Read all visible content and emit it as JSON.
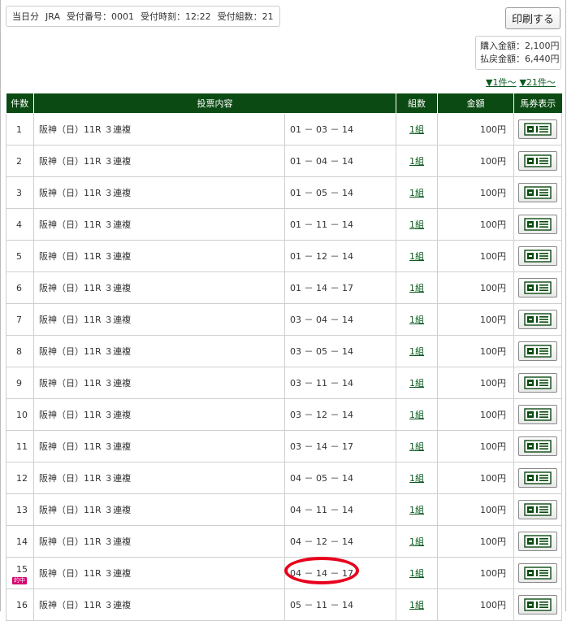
{
  "header": {
    "date_label": "当日分",
    "org": "JRA",
    "receipt_no": "受付番号：0001",
    "receipt_time": "受付時刻：12:22",
    "receipt_count": "受付組数：21"
  },
  "print_button": "印刷する",
  "amounts": {
    "purchase": "購入金額：2,100円",
    "payout": "払戻金額：6,440円"
  },
  "jump_links": [
    "▼1件～",
    "▼21件～"
  ],
  "table": {
    "headers": [
      "件数",
      "投票内容",
      "組数",
      "金額",
      "馬券表示"
    ],
    "hit_badge": "的中",
    "rows": [
      {
        "idx": "1",
        "race": "阪神（日）11R ３連複",
        "combo": "01 － 03 － 14",
        "kumi": "1組",
        "amount": "100円",
        "hit": false
      },
      {
        "idx": "2",
        "race": "阪神（日）11R ３連複",
        "combo": "01 － 04 － 14",
        "kumi": "1組",
        "amount": "100円",
        "hit": false
      },
      {
        "idx": "3",
        "race": "阪神（日）11R ３連複",
        "combo": "01 － 05 － 14",
        "kumi": "1組",
        "amount": "100円",
        "hit": false
      },
      {
        "idx": "4",
        "race": "阪神（日）11R ３連複",
        "combo": "01 － 11 － 14",
        "kumi": "1組",
        "amount": "100円",
        "hit": false
      },
      {
        "idx": "5",
        "race": "阪神（日）11R ３連複",
        "combo": "01 － 12 － 14",
        "kumi": "1組",
        "amount": "100円",
        "hit": false
      },
      {
        "idx": "6",
        "race": "阪神（日）11R ３連複",
        "combo": "01 － 14 － 17",
        "kumi": "1組",
        "amount": "100円",
        "hit": false
      },
      {
        "idx": "7",
        "race": "阪神（日）11R ３連複",
        "combo": "03 － 04 － 14",
        "kumi": "1組",
        "amount": "100円",
        "hit": false
      },
      {
        "idx": "8",
        "race": "阪神（日）11R ３連複",
        "combo": "03 － 05 － 14",
        "kumi": "1組",
        "amount": "100円",
        "hit": false
      },
      {
        "idx": "9",
        "race": "阪神（日）11R ３連複",
        "combo": "03 － 11 － 14",
        "kumi": "1組",
        "amount": "100円",
        "hit": false
      },
      {
        "idx": "10",
        "race": "阪神（日）11R ３連複",
        "combo": "03 － 12 － 14",
        "kumi": "1組",
        "amount": "100円",
        "hit": false
      },
      {
        "idx": "11",
        "race": "阪神（日）11R ３連複",
        "combo": "03 － 14 － 17",
        "kumi": "1組",
        "amount": "100円",
        "hit": false
      },
      {
        "idx": "12",
        "race": "阪神（日）11R ３連複",
        "combo": "04 － 05 － 14",
        "kumi": "1組",
        "amount": "100円",
        "hit": false
      },
      {
        "idx": "13",
        "race": "阪神（日）11R ３連複",
        "combo": "04 － 11 － 14",
        "kumi": "1組",
        "amount": "100円",
        "hit": false
      },
      {
        "idx": "14",
        "race": "阪神（日）11R ３連複",
        "combo": "04 － 12 － 14",
        "kumi": "1組",
        "amount": "100円",
        "hit": false
      },
      {
        "idx": "15",
        "race": "阪神（日）11R ３連複",
        "combo": "04 － 14 － 17",
        "kumi": "1組",
        "amount": "100円",
        "hit": true
      },
      {
        "idx": "16",
        "race": "阪神（日）11R ３連複",
        "combo": "05 － 11 － 14",
        "kumi": "1組",
        "amount": "100円",
        "hit": false
      }
    ]
  },
  "colors": {
    "header_green": "#0b4a12",
    "link_green": "#0a5a1e",
    "hit_pink": "#d6006f",
    "highlight_red": "#e8001c"
  },
  "icons": {
    "ticket": "ticket-icon"
  }
}
